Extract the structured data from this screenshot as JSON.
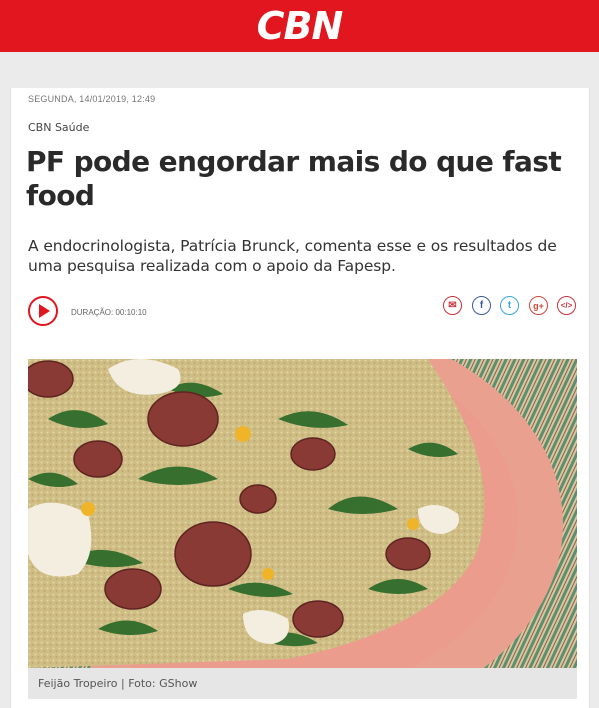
{
  "header": {
    "logo": "CBN",
    "brand_color": "#e1161f"
  },
  "article": {
    "date": "SEGUNDA, 14/01/2019, 12:49",
    "section": "CBN Saúde",
    "headline": "PF pode engordar mais do que fast food",
    "summary": "A endocrinologista, Patrícia Brunck, comenta esse e os resultados de uma pesquisa realizada com o apoio da Fapesp.",
    "duration_label": "DURAÇÃO: 00:10:10",
    "caption": "Feijão Tropeiro | Foto: GShow"
  },
  "share": {
    "icons": [
      "email-icon",
      "facebook-icon",
      "twitter-icon",
      "google-plus-icon",
      "embed-icon"
    ],
    "email_glyph": "✉",
    "facebook_glyph": "f",
    "twitter_glyph": "t",
    "google_plus_glyph": "g+",
    "embed_glyph": "</>"
  },
  "player": {
    "icon": "play-icon"
  },
  "photo": {
    "subject": "feijão tropeiro dish",
    "plate_color": "#e9a08e"
  }
}
